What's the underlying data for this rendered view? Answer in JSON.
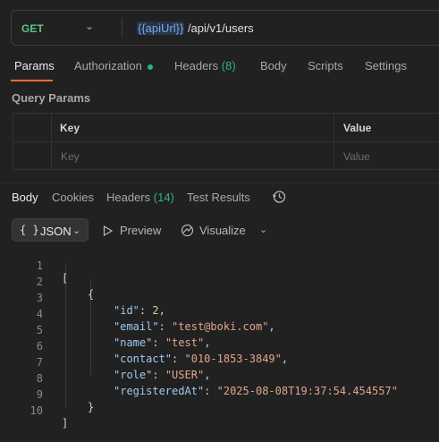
{
  "request": {
    "method": "GET",
    "url_variable": "{{apiUrl}}",
    "url_path": " /api/v1/users"
  },
  "request_tabs": [
    {
      "label": "Params",
      "active": true
    },
    {
      "label": "Authorization",
      "indicator": "green-dot"
    },
    {
      "label": "Headers",
      "count": "(8)"
    },
    {
      "label": "Body"
    },
    {
      "label": "Scripts"
    },
    {
      "label": "Settings"
    }
  ],
  "query_params": {
    "title": "Query Params",
    "columns": [
      "Key",
      "Value"
    ],
    "placeholders": [
      "Key",
      "Value"
    ]
  },
  "response_tabs": [
    {
      "label": "Body",
      "active": true
    },
    {
      "label": "Cookies"
    },
    {
      "label": "Headers",
      "count": "(14)"
    },
    {
      "label": "Test Results"
    }
  ],
  "response_toolbar": {
    "format_icon": "{ }",
    "format": "JSON",
    "preview": "Preview",
    "visualize": "Visualize"
  },
  "response_body": {
    "line_numbers": [
      "1",
      "2",
      "3",
      "4",
      "5",
      "6",
      "7",
      "8",
      "9",
      "10"
    ],
    "lines": [
      "[",
      "{",
      "\"id\": 2,",
      "\"email\": \"test@boki.com\",",
      "\"name\": \"test\",",
      "\"contact\": \"010-1853-3849\",",
      "\"role\": \"USER\",",
      "\"registeredAt\": \"2025-08-08T19:37:54.454557\"",
      "}",
      "]"
    ],
    "json": [
      {
        "id": 2,
        "email": "test@boki.com",
        "name": "test",
        "contact": "010-1853-3849",
        "role": "USER",
        "registeredAt": "2025-08-08T19:37:54.454557"
      }
    ]
  },
  "colors": {
    "method_get": "#5cc28a",
    "accent": "#ff6c37",
    "status_dot": "#2fb37b",
    "url_variable": "#7ea6e0",
    "json_key": "#9cc9f2",
    "json_string": "#e0a58e",
    "json_number": "#b5d8a0"
  }
}
